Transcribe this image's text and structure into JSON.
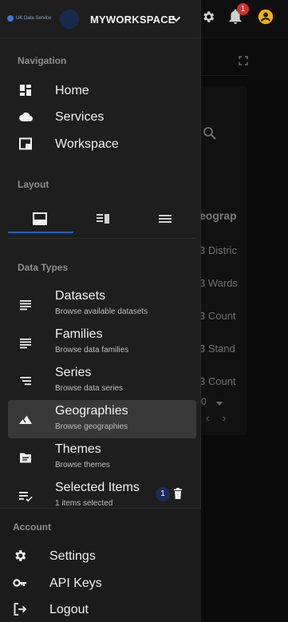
{
  "header": {
    "logo_text": "UK Data Service",
    "workspace_name": "MYWORKSPACE",
    "notification_count": "1"
  },
  "background": {
    "column_header": "eograp",
    "rows": [
      "3 Distric",
      "3 Wards",
      "3 Count",
      "3 Stand",
      "3 Count"
    ],
    "page_size": "0"
  },
  "navigation": {
    "title": "Navigation",
    "items": [
      {
        "label": "Home",
        "icon": "dashboard-icon"
      },
      {
        "label": "Services",
        "icon": "cloud-icon"
      },
      {
        "label": "Workspace",
        "icon": "window-icon"
      }
    ]
  },
  "layout": {
    "title": "Layout",
    "tabs": [
      {
        "icon": "panel-bottom-icon",
        "selected": true
      },
      {
        "icon": "panel-split-icon",
        "selected": false
      },
      {
        "icon": "list-rows-icon",
        "selected": false
      }
    ]
  },
  "data_types": {
    "title": "Data Types",
    "items": [
      {
        "title": "Datasets",
        "subtitle": "Browse available datasets",
        "icon": "notes-icon"
      },
      {
        "title": "Families",
        "subtitle": "Browse data families",
        "icon": "notes-icon"
      },
      {
        "title": "Series",
        "subtitle": "Browse data series",
        "icon": "sort-lines-icon"
      },
      {
        "title": "Geographies",
        "subtitle": "Browse geographies",
        "icon": "terrain-icon"
      },
      {
        "title": "Themes",
        "subtitle": "Browse themes",
        "icon": "topic-icon"
      },
      {
        "title": "Selected Items",
        "subtitle": "1 items selected",
        "icon": "playlist-check-icon",
        "count": "1"
      }
    ]
  },
  "account": {
    "title": "Account",
    "items": [
      {
        "label": "Settings",
        "icon": "gear-icon"
      },
      {
        "label": "API Keys",
        "icon": "key-icon"
      },
      {
        "label": "Logout",
        "icon": "logout-icon"
      }
    ]
  },
  "colors": {
    "accent": "#1565c0",
    "badge": "#d32f2f",
    "account_icon": "#f5b400"
  }
}
